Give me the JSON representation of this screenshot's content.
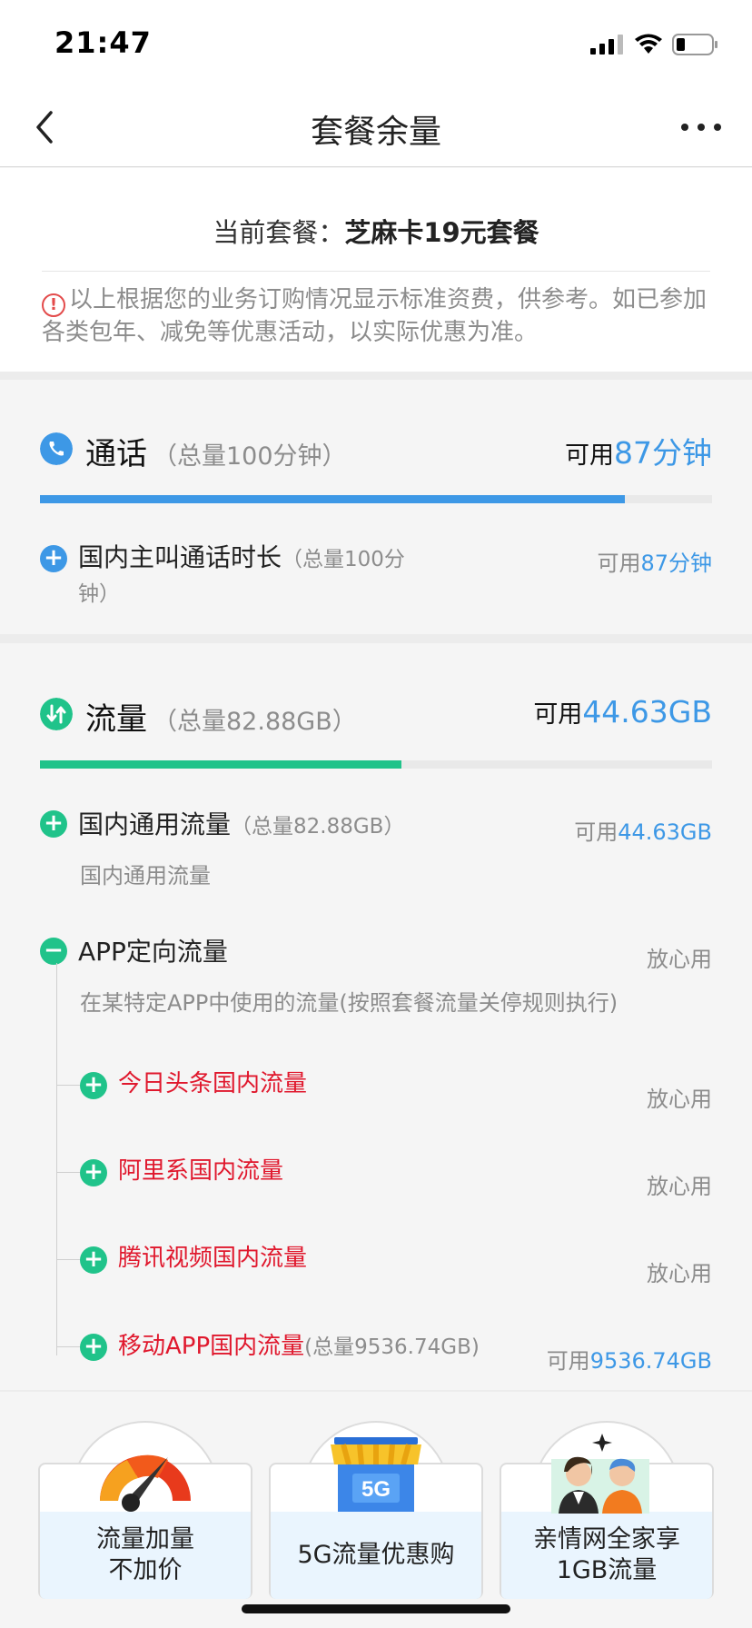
{
  "status_bar": {
    "time": "21:47"
  },
  "nav": {
    "title": "套餐余量"
  },
  "plan": {
    "label": "当前套餐：",
    "name": "芝麻卡19元套餐",
    "notice": "以上根据您的业务订购情况显示标准资费，供参考。如已参加各类包年、减免等优惠活动，以实际优惠为准。"
  },
  "call": {
    "title": "通话",
    "total": "（总量100分钟）",
    "avail_label": "可用",
    "avail_value": "87分钟",
    "progress": 0.87,
    "color": "#3d98e6",
    "items": [
      {
        "name": "国内主叫通话时长",
        "total_line1": "（总量100分",
        "total_line2": "钟）",
        "avail_label": "可用",
        "avail_value": "87分钟"
      }
    ]
  },
  "data": {
    "title": "流量",
    "total": "（总量82.88GB）",
    "avail_label": "可用",
    "avail_value": "44.63GB",
    "progress": 0.538,
    "color": "#20c38a",
    "general": {
      "name": "国内通用流量",
      "total": "（总量82.88GB）",
      "avail_label": "可用",
      "avail_value": "44.63GB",
      "desc": "国内通用流量"
    },
    "app": {
      "name": "APP定向流量",
      "status": "放心用",
      "desc": "在某特定APP中使用的流量(按照套餐流量关停规则执行)",
      "children": [
        {
          "name": "今日头条国内流量",
          "status": "放心用"
        },
        {
          "name": "阿里系国内流量",
          "status": "放心用"
        },
        {
          "name": "腾讯视频国内流量",
          "status": "放心用"
        },
        {
          "name": "移动APP国内流量",
          "total": "(总量9536.74GB)",
          "avail_label": "可用",
          "avail_value": "9536.74GB"
        }
      ]
    }
  },
  "promos": [
    {
      "line1": "流量加量",
      "line2": "不加价",
      "icon": "speedometer-icon"
    },
    {
      "line1": "5G流量优惠购",
      "line2": "",
      "icon": "5g-shop-icon",
      "badge": "5G"
    },
    {
      "line1": "亲情网全家享",
      "line2": "1GB流量",
      "icon": "family-icon"
    }
  ]
}
